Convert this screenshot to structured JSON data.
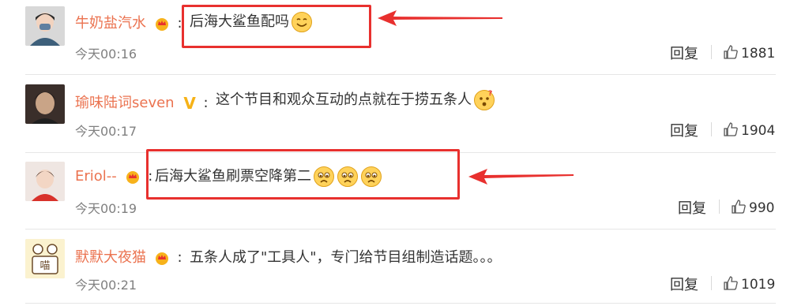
{
  "comments": [
    {
      "username": "牛奶盐汽水",
      "badge": "crown-badge",
      "text": "后海大鲨鱼配吗",
      "emojis": [
        "smile-emoji"
      ],
      "time": "今天00:16",
      "reply_label": "回复",
      "likes": "1881",
      "highlighted": true
    },
    {
      "username": "瑜味陆词seven",
      "badge": "v-badge",
      "text": "这个节目和观众互动的点就在于捞五条人",
      "emojis": [
        "confused-emoji"
      ],
      "time": "今天00:17",
      "reply_label": "回复",
      "likes": "1904",
      "highlighted": false
    },
    {
      "username": "Eriol--",
      "badge": "crown-badge",
      "text": "后海大鲨鱼刷票空降第二",
      "emojis": [
        "sad-emoji",
        "sad-emoji",
        "sad-emoji"
      ],
      "time": "今天00:19",
      "reply_label": "回复",
      "likes": "990",
      "highlighted": true
    },
    {
      "username": "默默大夜猫",
      "badge": "crown-badge",
      "text": "五条人成了\"工具人\"，专门给节目组制造话题。。。",
      "emojis": [],
      "time": "今天00:21",
      "reply_label": "回复",
      "likes": "1019",
      "highlighted": false
    }
  ],
  "colors": {
    "username": "#eb7350",
    "highlight": "#e8302e",
    "time": "#808080"
  }
}
